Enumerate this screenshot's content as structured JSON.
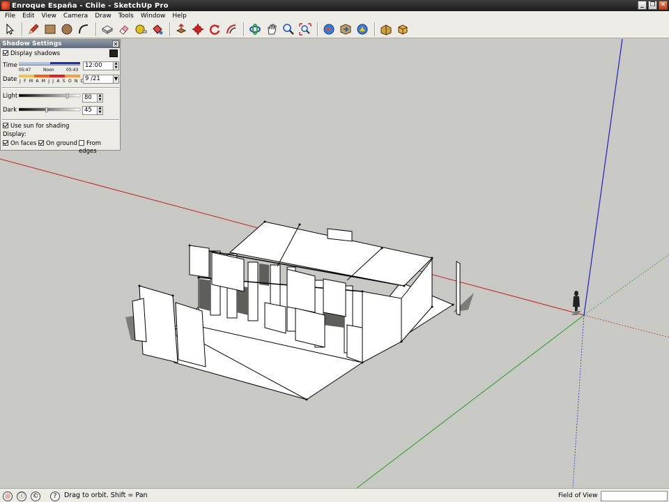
{
  "window": {
    "title": "Enroque España - Chile - SketchUp Pro",
    "minimize": "_",
    "restore": "❐",
    "close": "✕"
  },
  "menu": [
    "File",
    "Edit",
    "View",
    "Camera",
    "Draw",
    "Tools",
    "Window",
    "Help"
  ],
  "toolbar": {
    "tools": [
      "select-icon",
      "pencil-icon",
      "rectangle-icon",
      "circle-icon",
      "arc-icon",
      "make-component-icon",
      "eraser-icon",
      "tape-measure-icon",
      "paint-bucket-icon",
      "push-pull-icon",
      "move-icon",
      "rotate-icon",
      "offset-icon",
      "orbit-icon",
      "pan-icon",
      "zoom-icon",
      "zoom-extents-icon",
      "get-models-icon",
      "share-model-icon",
      "share-component-icon",
      "extension-warehouse-icon",
      "layout-icon"
    ]
  },
  "shadow_settings": {
    "title": "Shadow Settings",
    "close": "✕",
    "display_shadows": "Display shadows",
    "time_label": "Time",
    "time_start": "05:47",
    "time_noon": "Noon",
    "time_end": "05:43",
    "time_value": "12:00",
    "date_label": "Date",
    "months": "J F M A M J J A S O N D",
    "date_value": "9 /21",
    "light_label": "Light",
    "light_value": "80",
    "light_level": 0.8,
    "dark_label": "Dark",
    "dark_value": "45",
    "dark_level": 0.45,
    "use_sun": "Use sun for shading",
    "display_label": "Display:",
    "on_faces": "On faces",
    "on_ground": "On ground",
    "from_edges": "From edges",
    "display_shadows_checked": true,
    "use_sun_checked": true,
    "on_faces_checked": true,
    "on_ground_checked": true,
    "from_edges_checked": false
  },
  "status": {
    "hint": "Drag to orbit.  Shift = Pan",
    "fov_label": "Field of View",
    "fov_value": ""
  },
  "colors": {
    "red_axis": "#c81e1e",
    "green_axis": "#1ea01e",
    "blue_axis": "#1e1ec8",
    "shadow": "#7c7c78",
    "face": "#ffffff"
  }
}
